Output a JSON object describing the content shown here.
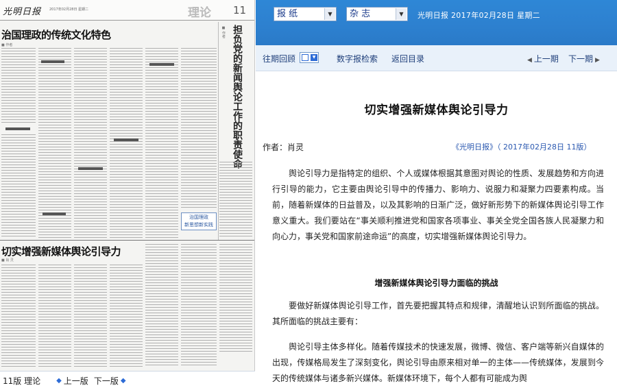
{
  "paper": {
    "masthead_logo": "光明日报",
    "masthead_meta": "2017年02月28日 星期二",
    "section": "理论",
    "page_number": "11",
    "headline_top": "治国理政的传统文化特色",
    "vertical_title": "担负党的新闻舆论工作的职责使命",
    "badge_text": [
      "治国理政",
      "新思想新实践"
    ],
    "headline_bottom": "切实增强新媒体舆论引导力"
  },
  "page_nav": {
    "current": "11版 理论",
    "prev": "上一版",
    "next": "下一版"
  },
  "toolbar": {
    "select_newspaper": "报 纸",
    "select_magazine": "杂 志",
    "date_line": "光明日报 2017年02月28日 星期二"
  },
  "navbar": {
    "review": "往期回顾",
    "digital_search": "数字报检索",
    "back_to_index": "返回目录",
    "prev_issue": "上一期",
    "next_issue": "下一期"
  },
  "article": {
    "title": "切实增强新媒体舆论引导力",
    "author": "作者：肖灵",
    "source": "《光明日报》（ 2017年02月28日 11版）",
    "paragraphs": [
      "舆论引导力是指特定的组织、个人或媒体根据其意图对舆论的性质、发展趋势和方向进行引导的能力，它主要由舆论引导中的传播力、影响力、说服力和凝聚力四要素构成。当前，随着新媒体的日益普及，以及其影响的日渐广泛，做好新形势下的新媒体舆论引导工作意义重大。我们要站在“事关顺利推进党和国家各项事业、事关全党全国各族人民凝聚力和向心力，事关党和国家前途命运”的高度，切实增强新媒体舆论引导力。",
      "要做好新媒体舆论引导工作，首先要把握其特点和规律，清醒地认识到所面临的挑战。其所面临的挑战主要有：",
      "舆论引导主体多样化。随着传媒技术的快速发展，微博、微信、客户端等新兴自媒体的出现，传媒格局发生了深刻变化，舆论引导由原来相对单一的主体——传统媒体，发展到今天的传统媒体与诸多新兴媒体。新媒体环境下，每个人都有可能成为舆"
    ],
    "section_head": "增强新媒体舆论引导力面临的挑战"
  },
  "colors": {
    "toolbar_blue": "#2d80cf",
    "navbar_bg": "#e9f1fa",
    "link_blue": "#2a58b0"
  }
}
